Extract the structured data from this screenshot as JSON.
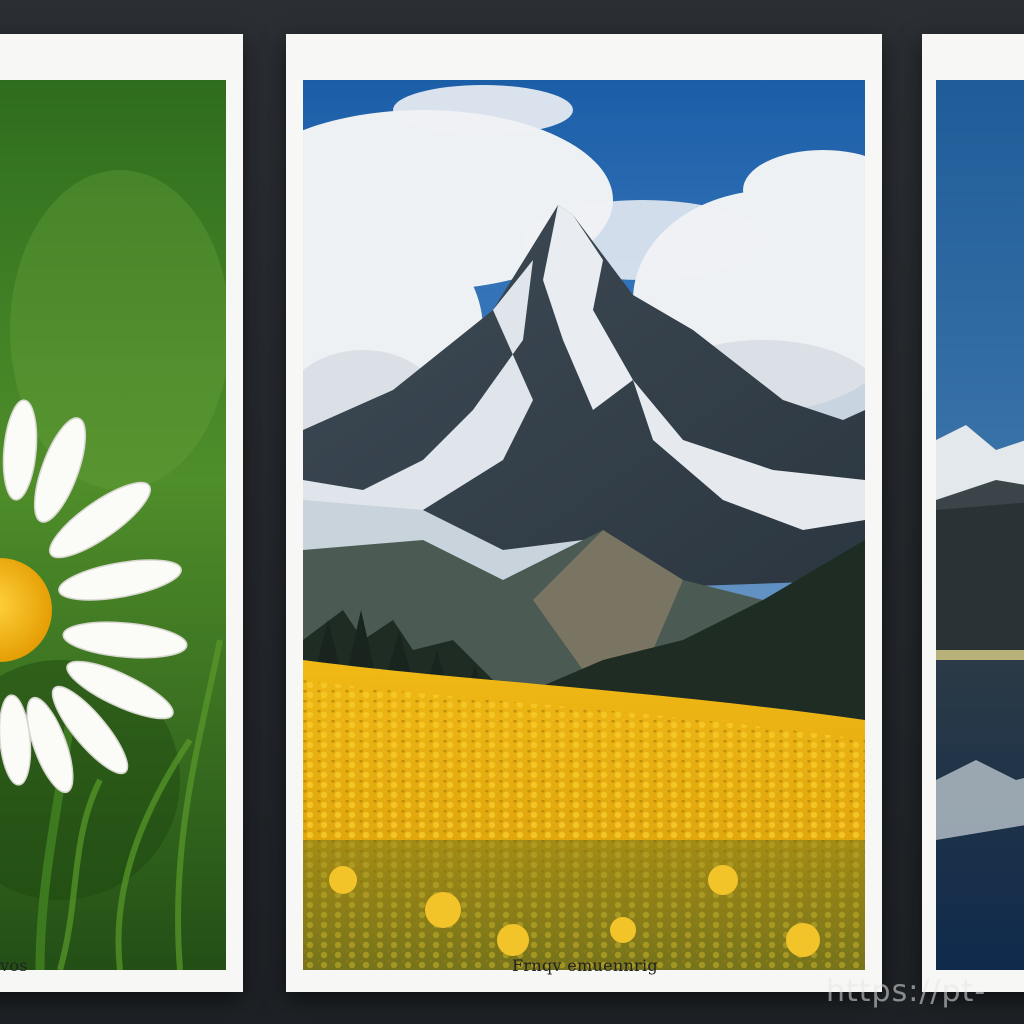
{
  "cards": [
    {
      "caption": "vos",
      "subject": "daisy"
    },
    {
      "caption": "Frnqv emuennrig",
      "subject": "mountain"
    },
    {
      "caption": "",
      "subject": "mountain-lake"
    }
  ],
  "watermark": "https://pt-"
}
